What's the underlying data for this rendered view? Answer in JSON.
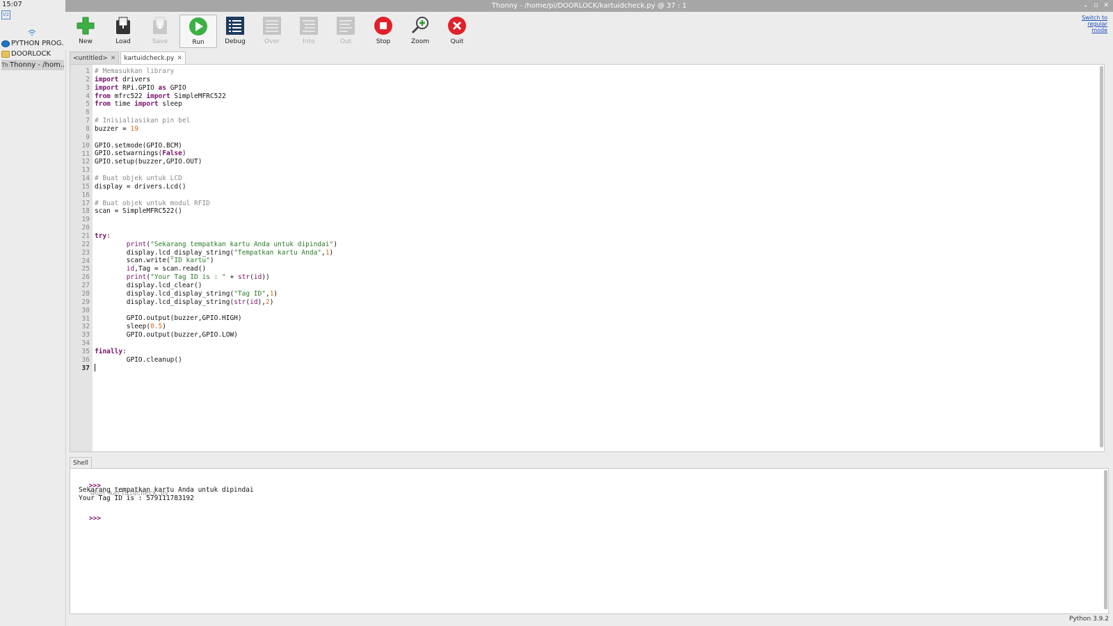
{
  "taskbar": {
    "clock": "15:07",
    "vnc_label": "V2",
    "items": [
      {
        "label": "PYTHON PROG..."
      },
      {
        "label": "DOORLOCK"
      },
      {
        "label": "Thonny  -  /hom..."
      }
    ]
  },
  "window": {
    "title": "Thonny  -  /home/pi/DOORLOCK/kartuidcheck.py  @  37 : 1",
    "controls": [
      "⌄",
      "▫",
      "✕"
    ]
  },
  "toolbar": {
    "buttons": [
      {
        "label": "New",
        "icon": "new-icon",
        "enabled": true
      },
      {
        "label": "Load",
        "icon": "load-icon",
        "enabled": true
      },
      {
        "label": "Save",
        "icon": "save-icon",
        "enabled": false
      },
      {
        "label": "Run",
        "icon": "run-icon",
        "enabled": true
      },
      {
        "label": "Debug",
        "icon": "debug-icon",
        "enabled": true
      },
      {
        "label": "Over",
        "icon": "step-over-icon",
        "enabled": false
      },
      {
        "label": "Into",
        "icon": "step-into-icon",
        "enabled": false
      },
      {
        "label": "Out",
        "icon": "step-out-icon",
        "enabled": false
      },
      {
        "label": "Stop",
        "icon": "stop-icon",
        "enabled": true
      },
      {
        "label": "Zoom",
        "icon": "zoom-icon",
        "enabled": true
      },
      {
        "label": "Quit",
        "icon": "quit-icon",
        "enabled": true
      }
    ],
    "switch_mode": [
      "Switch to",
      "regular",
      "mode"
    ]
  },
  "tabs": [
    {
      "label": "<untitled>",
      "close": "✕"
    },
    {
      "label": "kartuidcheck.py",
      "close": "✕"
    }
  ],
  "editor": {
    "lines": [
      [
        [
          "c",
          "# Memasukkan library"
        ]
      ],
      [
        [
          "k",
          "import"
        ],
        [
          "",
          " drivers"
        ]
      ],
      [
        [
          "k",
          "import"
        ],
        [
          "",
          " RPi.GPIO "
        ],
        [
          "k",
          "as"
        ],
        [
          "",
          " GPIO"
        ]
      ],
      [
        [
          "k",
          "from"
        ],
        [
          "",
          " mfrc522 "
        ],
        [
          "k",
          "import"
        ],
        [
          "",
          " SimpleMFRC522"
        ]
      ],
      [
        [
          "k",
          "from"
        ],
        [
          "",
          " time "
        ],
        [
          "k",
          "import"
        ],
        [
          "",
          " sleep"
        ]
      ],
      [
        [
          "",
          ""
        ]
      ],
      [
        [
          "c",
          "# Inisialiasikan pin bel"
        ]
      ],
      [
        [
          "",
          "buzzer = "
        ],
        [
          "n",
          "19"
        ]
      ],
      [
        [
          "",
          ""
        ]
      ],
      [
        [
          "",
          "GPIO.setmode(GPIO.BCM)"
        ]
      ],
      [
        [
          "",
          "GPIO.setwarnings("
        ],
        [
          "k",
          "False"
        ],
        [
          "",
          ")"
        ]
      ],
      [
        [
          "",
          "GPIO.setup(buzzer,GPIO.OUT)"
        ]
      ],
      [
        [
          "",
          ""
        ]
      ],
      [
        [
          "c",
          "# Buat objek untuk LCD"
        ]
      ],
      [
        [
          "",
          "display = drivers.Lcd()"
        ]
      ],
      [
        [
          "",
          ""
        ]
      ],
      [
        [
          "c",
          "# Buat objek untuk modul RFID"
        ]
      ],
      [
        [
          "",
          "scan = SimpleMFRC522()"
        ]
      ],
      [
        [
          "",
          ""
        ]
      ],
      [
        [
          "",
          ""
        ]
      ],
      [
        [
          "k",
          "try"
        ],
        [
          "",
          ":"
        ]
      ],
      [
        [
          "",
          "        "
        ],
        [
          "b",
          "print"
        ],
        [
          "",
          "("
        ],
        [
          "s",
          "\"Sekarang tempatkan kartu Anda untuk dipindai\""
        ],
        [
          "",
          ")"
        ]
      ],
      [
        [
          "",
          "        display.lcd_display_string("
        ],
        [
          "s",
          "\"Tempatkan kartu Anda\""
        ],
        [
          "",
          ","
        ],
        [
          "n",
          "1"
        ],
        [
          "",
          ")"
        ]
      ],
      [
        [
          "",
          "        scan.write("
        ],
        [
          "s",
          "\"ID kartu\""
        ],
        [
          "",
          ")"
        ]
      ],
      [
        [
          "",
          "        "
        ],
        [
          "b",
          "id"
        ],
        [
          "",
          ",Tag = scan.read()"
        ]
      ],
      [
        [
          "",
          "        "
        ],
        [
          "b",
          "print"
        ],
        [
          "",
          "("
        ],
        [
          "s",
          "\"Your Tag ID is : \""
        ],
        [
          "",
          " + "
        ],
        [
          "b",
          "str"
        ],
        [
          "",
          "("
        ],
        [
          "b",
          "id"
        ],
        [
          "",
          "))"
        ]
      ],
      [
        [
          "",
          "        display.lcd_clear()"
        ]
      ],
      [
        [
          "",
          "        display.lcd_display_string("
        ],
        [
          "s",
          "\"Tag ID\""
        ],
        [
          "",
          ","
        ],
        [
          "n",
          "1"
        ],
        [
          "",
          ")"
        ]
      ],
      [
        [
          "",
          "        display.lcd_display_string("
        ],
        [
          "b",
          "str"
        ],
        [
          "",
          "("
        ],
        [
          "b",
          "id"
        ],
        [
          "",
          "),"
        ],
        [
          "n",
          "2"
        ],
        [
          "",
          ")"
        ]
      ],
      [
        [
          "",
          ""
        ]
      ],
      [
        [
          "",
          "        GPIO.output(buzzer,GPIO.HIGH)"
        ]
      ],
      [
        [
          "",
          "        sleep("
        ],
        [
          "n",
          "0.5"
        ],
        [
          "",
          ")"
        ]
      ],
      [
        [
          "",
          "        GPIO.output(buzzer,GPIO.LOW)"
        ]
      ],
      [
        [
          "",
          ""
        ]
      ],
      [
        [
          "k",
          "finally"
        ],
        [
          "",
          ":"
        ]
      ],
      [
        [
          "",
          "        GPIO.cleanup()"
        ]
      ],
      [
        [
          "",
          ""
        ]
      ]
    ]
  },
  "shell": {
    "tab_label": "Shell",
    "prompt": ">>>",
    "command": "%Run kartuidcheck.py",
    "output": [
      "Sekarang tempatkan kartu Anda untuk dipindai",
      "Your Tag ID is : 579111783192"
    ]
  },
  "status": {
    "python_version": "Python 3.9.2"
  },
  "colors": {
    "keyword": "#7a0f6b",
    "comment": "#8a8a8a",
    "string": "#2a7a2a",
    "number": "#d06a1b"
  }
}
